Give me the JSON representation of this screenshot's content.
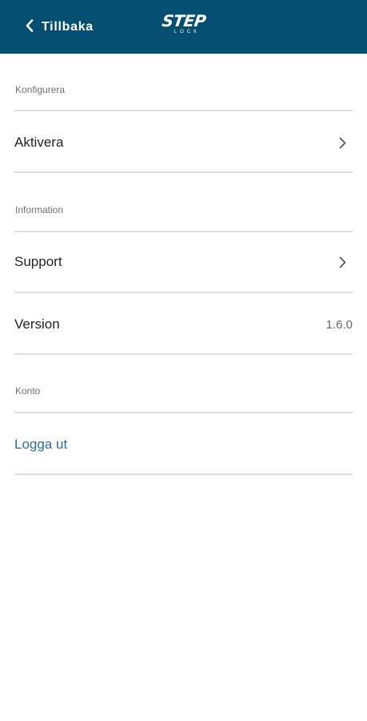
{
  "header": {
    "back_label": "Tillbaka",
    "logo_text": "STEP",
    "logo_subtext": "LOCK",
    "background": "#044e72"
  },
  "sections": [
    {
      "label": "Konfigurera"
    },
    {
      "label": "Information"
    },
    {
      "label": "Konto"
    }
  ],
  "rows": {
    "activate": {
      "label": "Aktivera",
      "icon": "chevron-right-icon"
    },
    "support": {
      "label": "Support",
      "icon": "chevron-right-icon"
    },
    "version": {
      "label": "Version",
      "value": "1.6.0"
    },
    "logout": {
      "label": "Logga ut",
      "color": "#2b6e93"
    }
  }
}
